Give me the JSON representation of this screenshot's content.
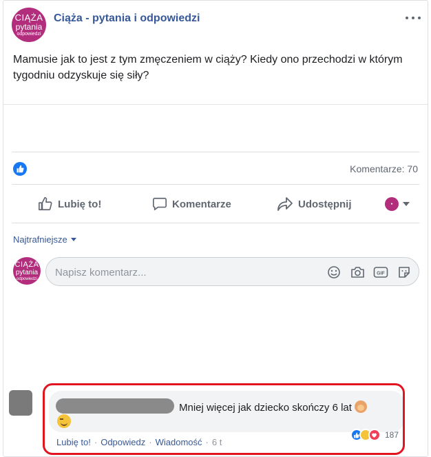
{
  "post": {
    "page_name": "Ciąża - pytania i odpowiedzi",
    "avatar_text": [
      "CIĄŻA",
      "pytania",
      "odpowiedzi"
    ],
    "text": "Mamusie jak to jest z tym zmęczeniem w ciąży? Kiedy ono przechodzi w którym tygodniu odzyskuje się siły?",
    "comments_count": "Komentarze: 70"
  },
  "actions": {
    "like": "Lubię to!",
    "comment": "Komentarze",
    "share": "Udostępnij"
  },
  "sort": {
    "label": "Najtrafniejsze"
  },
  "compose": {
    "placeholder": "Napisz komentarz..."
  },
  "comment": {
    "text": "Mniej więcej jak dziecko skończy 6 lat",
    "like": "Lubię to!",
    "reply": "Odpowiedz",
    "message": "Wiadomość",
    "time": "6 t",
    "reaction_count": "187"
  },
  "colors": {
    "brand": "#b22d7c",
    "link": "#365899",
    "highlight": "#e1141f",
    "like_blue": "#1877f2"
  }
}
